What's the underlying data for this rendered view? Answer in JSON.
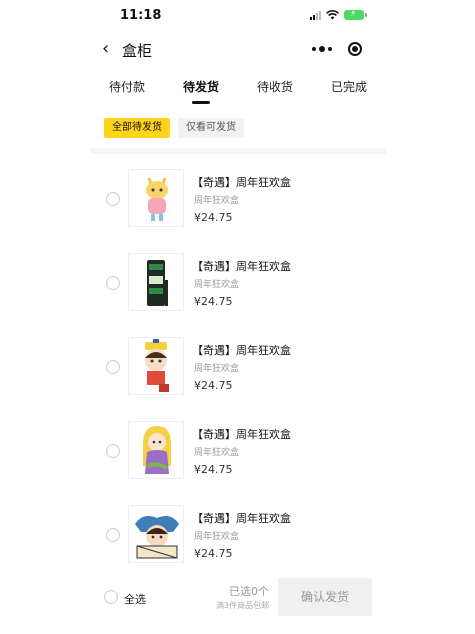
{
  "status_bar": {
    "time": "11:18"
  },
  "nav": {
    "title": "盒柜"
  },
  "tabs": [
    {
      "label": "待付款"
    },
    {
      "label": "待发货"
    },
    {
      "label": "待收货"
    },
    {
      "label": "已完成"
    }
  ],
  "active_tab": "待发货",
  "filters": [
    {
      "label": "全部待发货"
    },
    {
      "label": "仅看可发货"
    }
  ],
  "items": [
    {
      "name": "【奇遇】周年狂欢盒",
      "sub": "周年狂欢盒",
      "price": "¥24.75",
      "thumb_icon": "pink-dress-figure-icon"
    },
    {
      "name": "【奇遇】周年狂欢盒",
      "sub": "周年狂欢盒",
      "price": "¥24.75",
      "thumb_icon": "green-black-strap-icon"
    },
    {
      "name": "【奇遇】周年狂欢盒",
      "sub": "周年狂欢盒",
      "price": "¥24.75",
      "thumb_icon": "yellow-hat-figure-icon"
    },
    {
      "name": "【奇遇】周年狂欢盒",
      "sub": "周年狂欢盒",
      "price": "¥24.75",
      "thumb_icon": "blonde-princess-figure-icon"
    },
    {
      "name": "【奇遇】周年狂欢盒",
      "sub": "周年狂欢盒",
      "price": "¥24.75",
      "thumb_icon": "blue-jester-figure-icon"
    }
  ],
  "footer": {
    "select_all": "全选",
    "selected_count": "已选0个",
    "note": "满3件商品包邮",
    "confirm": "确认发货"
  },
  "colors": {
    "accent": "#ffd51c",
    "battery": "#4cd964"
  }
}
